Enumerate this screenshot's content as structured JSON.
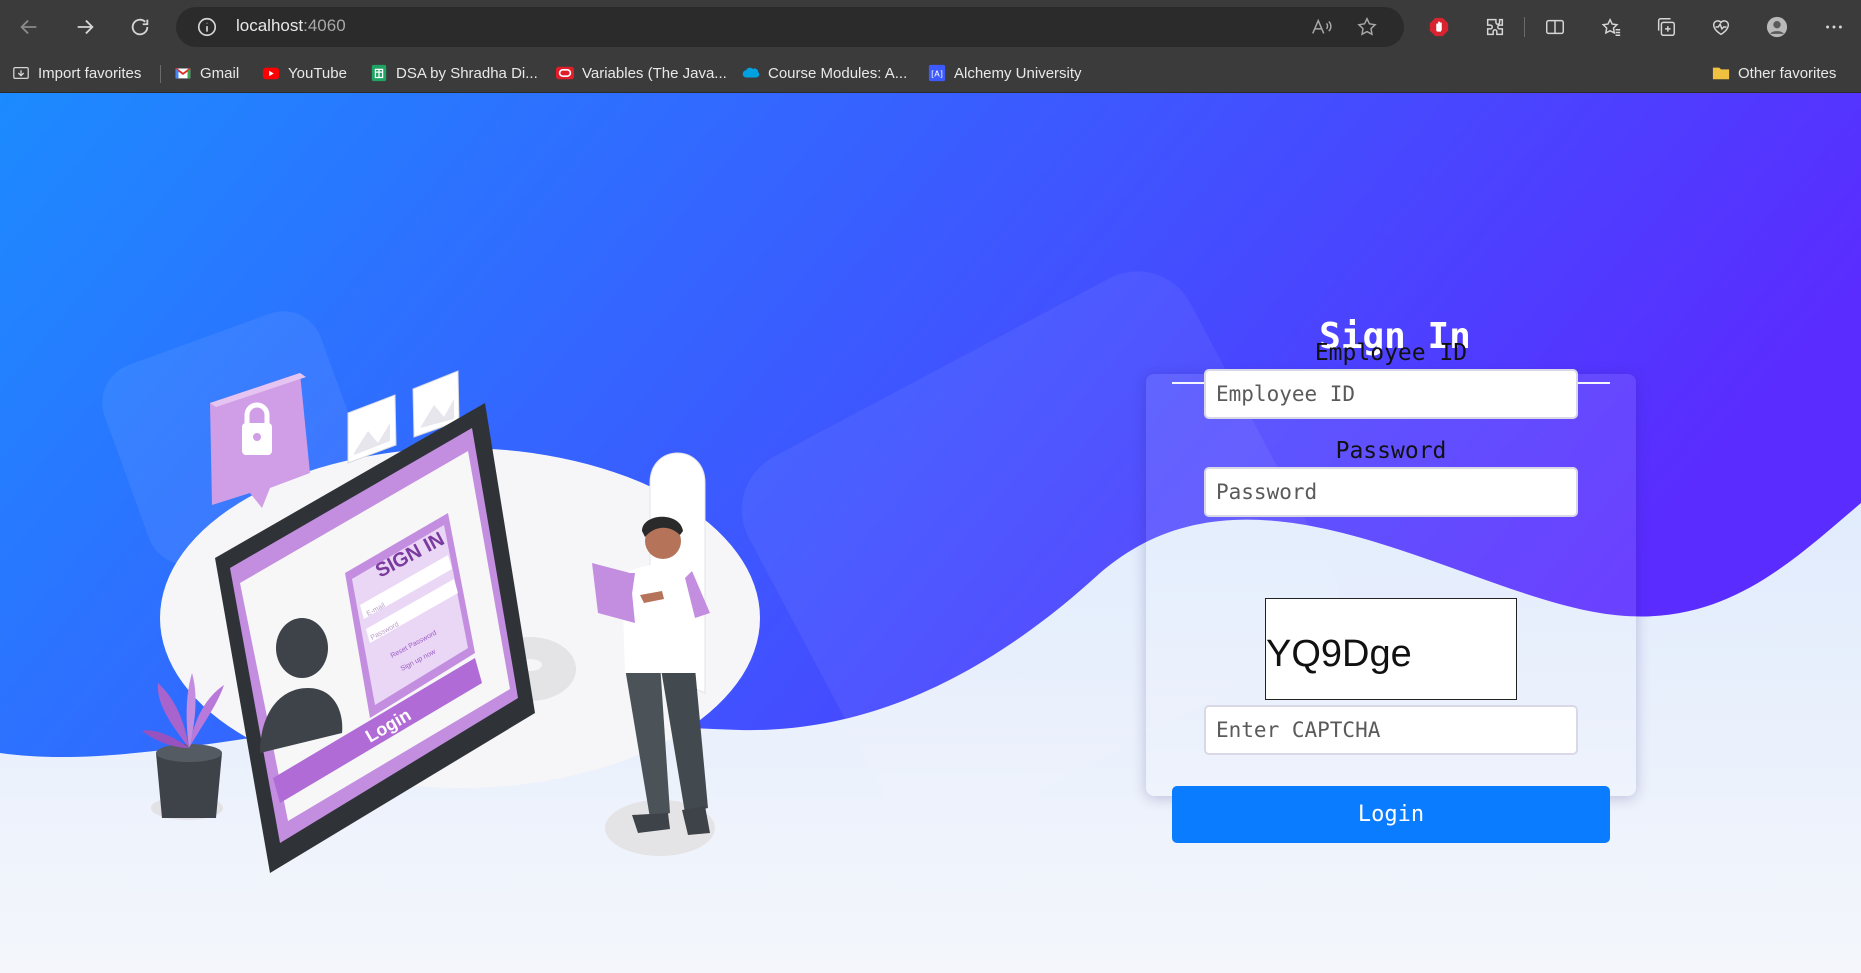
{
  "browser": {
    "url_host": "localhost",
    "url_port": ":4060",
    "bookmarks": [
      {
        "label": "Import favorites",
        "icon": "import-icon"
      },
      {
        "label": "Gmail",
        "icon": "gmail-icon"
      },
      {
        "label": "YouTube",
        "icon": "youtube-icon"
      },
      {
        "label": "DSA by Shradha Di...",
        "icon": "sheets-icon"
      },
      {
        "label": "Variables (The Java...",
        "icon": "oracle-icon"
      },
      {
        "label": "Course Modules: A...",
        "icon": "salesforce-icon"
      },
      {
        "label": "Alchemy University",
        "icon": "alchemy-icon"
      }
    ],
    "other_favorites": "Other favorites"
  },
  "illustration": {
    "tablet_title": "SIGN IN",
    "email_placeholder": "E-mail",
    "password_placeholder": "Password",
    "reset_link": "Reset Password",
    "signup_link": "Sign up now",
    "login_label": "Login"
  },
  "form": {
    "title": "Sign In",
    "employee_id_label": "Employee ID",
    "employee_id_placeholder": "Employee ID",
    "password_label": "Password",
    "password_placeholder": "Password",
    "captcha_text": "YQ9Dge",
    "captcha_placeholder": "Enter CAPTCHA",
    "login_button": "Login"
  },
  "colors": {
    "gradient_start": "#1c8bff",
    "gradient_end": "#5a2cff",
    "button": "#0a7cff",
    "illustration_purple": "#c48ee0"
  }
}
